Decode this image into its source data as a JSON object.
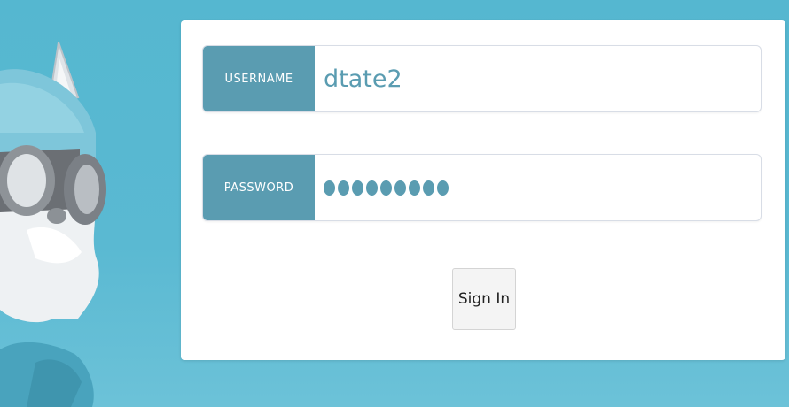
{
  "login_form": {
    "username_label": "USERNAME",
    "username_value": "dtate2",
    "password_label": "PASSWORD",
    "password_mask_count": 9,
    "signin_label": "Sign In"
  },
  "colors": {
    "background": "#5ab9d2",
    "addon": "#5a9cb1",
    "panel": "#ffffff"
  }
}
